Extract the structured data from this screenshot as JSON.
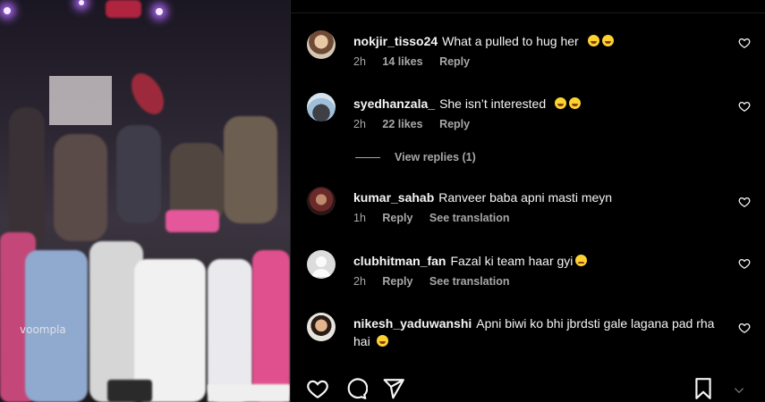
{
  "video": {
    "watermark": "voompla"
  },
  "comments": [
    {
      "username": "nokjir_tisso24",
      "text": "What a pulled to hug her",
      "emoji": "laugh-cry-emoji x2",
      "time": "2h",
      "likes": "14 likes",
      "reply": "Reply",
      "translate": ""
    },
    {
      "username": "syedhanzala_",
      "text": "She isn’t interested",
      "emoji": "laugh-cry-emoji x2",
      "time": "2h",
      "likes": "22 likes",
      "reply": "Reply",
      "translate": ""
    },
    {
      "username": "kumar_sahab",
      "text": "Ranveer baba apni masti meyn",
      "emoji": "",
      "time": "1h",
      "likes": "",
      "reply": "Reply",
      "translate": "See translation"
    },
    {
      "username": "clubhitman_fan",
      "text": "Fazal ki team haar gyi",
      "emoji": "sad-emoji",
      "time": "2h",
      "likes": "",
      "reply": "Reply",
      "translate": "See translation"
    },
    {
      "username": "nikesh_yaduwanshi",
      "text": "Apni biwi ko bhi jbrdsti gale lagana pad rha hai",
      "emoji": "laugh-cry-emoji",
      "time": "",
      "likes": "",
      "reply": "",
      "translate": ""
    }
  ],
  "view_replies": "View replies (1)",
  "actions": [
    "heart-icon",
    "comment-icon",
    "share-icon",
    "bookmark-icon"
  ],
  "colors": {
    "background": "#000000",
    "primary_text": "#f5f5f5",
    "secondary_text": "#a8a8a8"
  }
}
